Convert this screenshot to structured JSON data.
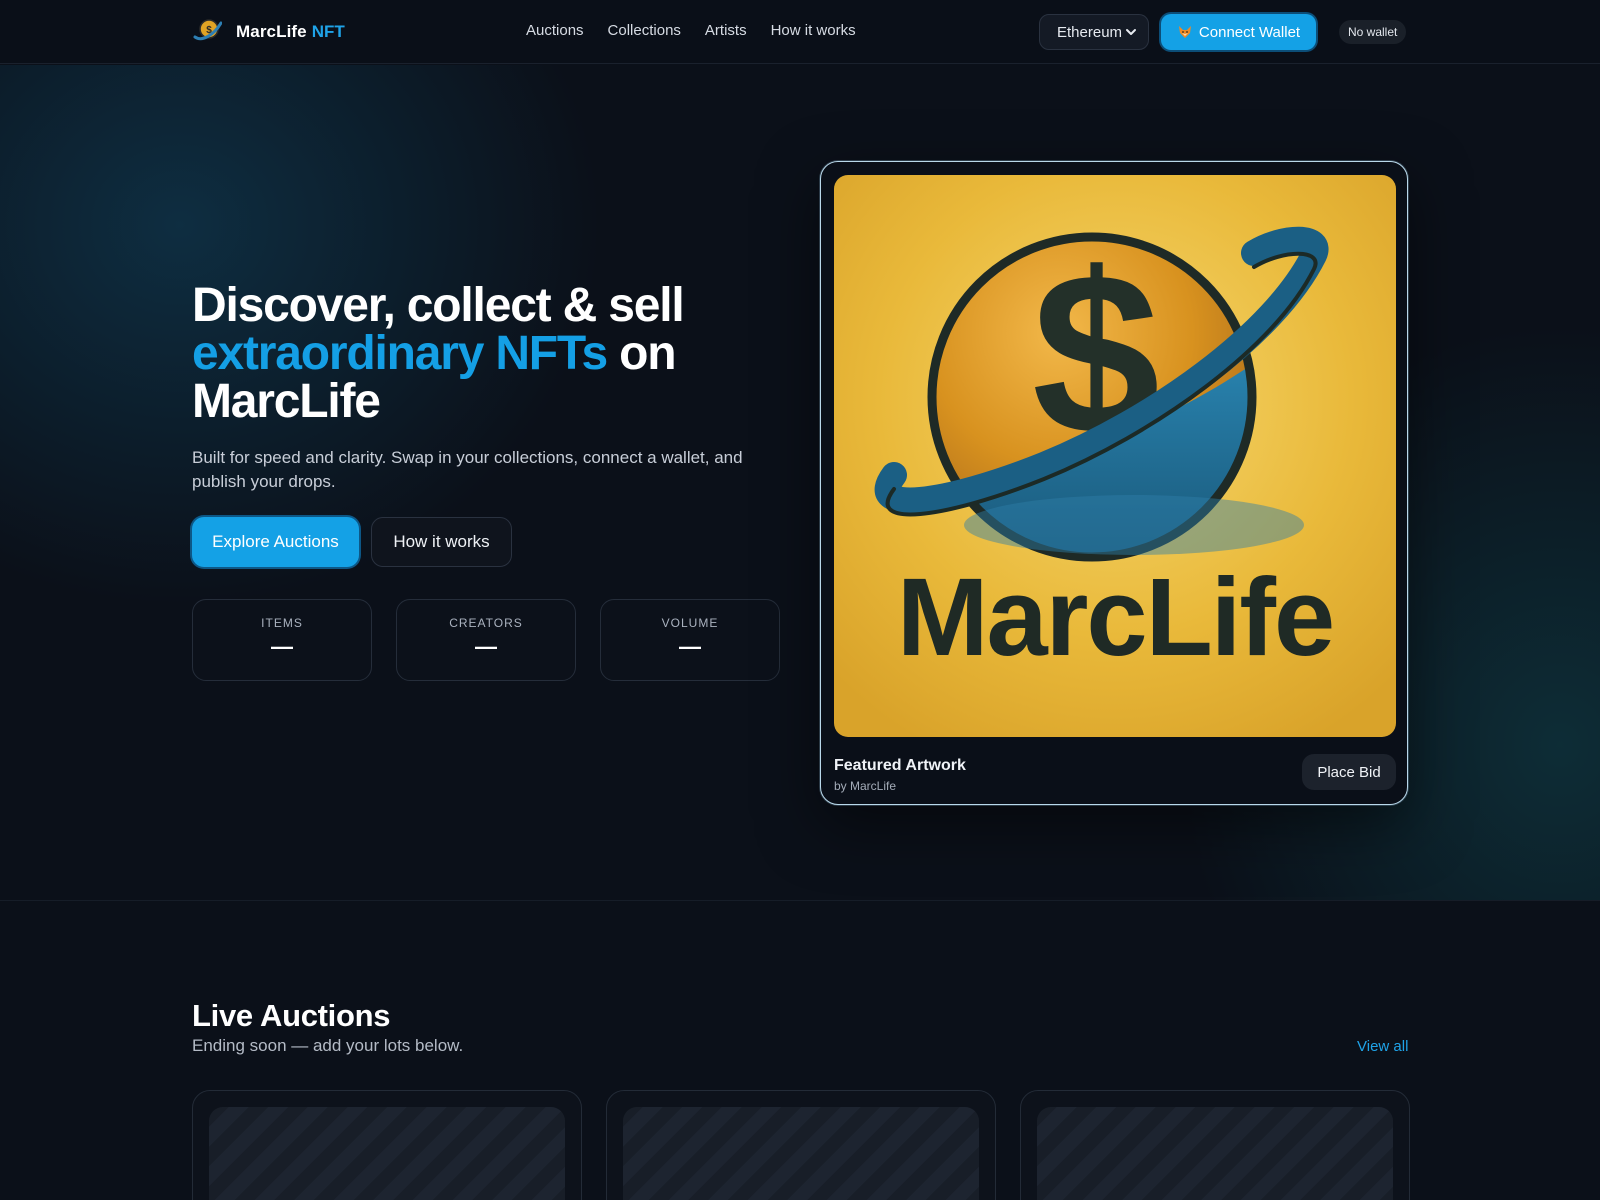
{
  "nav": {
    "brand_name": "MarcLife",
    "brand_accent": "NFT",
    "links": [
      "Auctions",
      "Collections",
      "Artists",
      "How it works"
    ],
    "network_selected": "Ethereum",
    "connect_label": "Connect Wallet",
    "connect_icon": "fox-emoji-icon",
    "wallet_status": "No wallet"
  },
  "hero": {
    "title_line1": "Discover, collect & sell",
    "title_accent": "extraordinary NFTs",
    "title_after_accent": " on",
    "title_line3": "MarcLife",
    "subtitle": "Built for speed and clarity. Swap in your collections, connect a wallet, and publish your drops.",
    "primary_cta": "Explore Auctions",
    "secondary_cta": "How it works",
    "stats": [
      {
        "label": "ITEMS",
        "value": "—"
      },
      {
        "label": "CREATORS",
        "value": "—"
      },
      {
        "label": "VOLUME",
        "value": "—"
      }
    ]
  },
  "featured": {
    "artwork_text": "MarcLife",
    "title": "Featured Artwork",
    "by": "by MarcLife",
    "bid_label": "Place Bid"
  },
  "auctions": {
    "title": "Live Auctions",
    "subtitle": "Ending soon — add your lots below.",
    "view_all": "View all"
  },
  "colors": {
    "accent": "#14a1e6",
    "background": "#0b1019",
    "art_gold": "#e9b93a",
    "art_blue": "#1f6d96"
  }
}
